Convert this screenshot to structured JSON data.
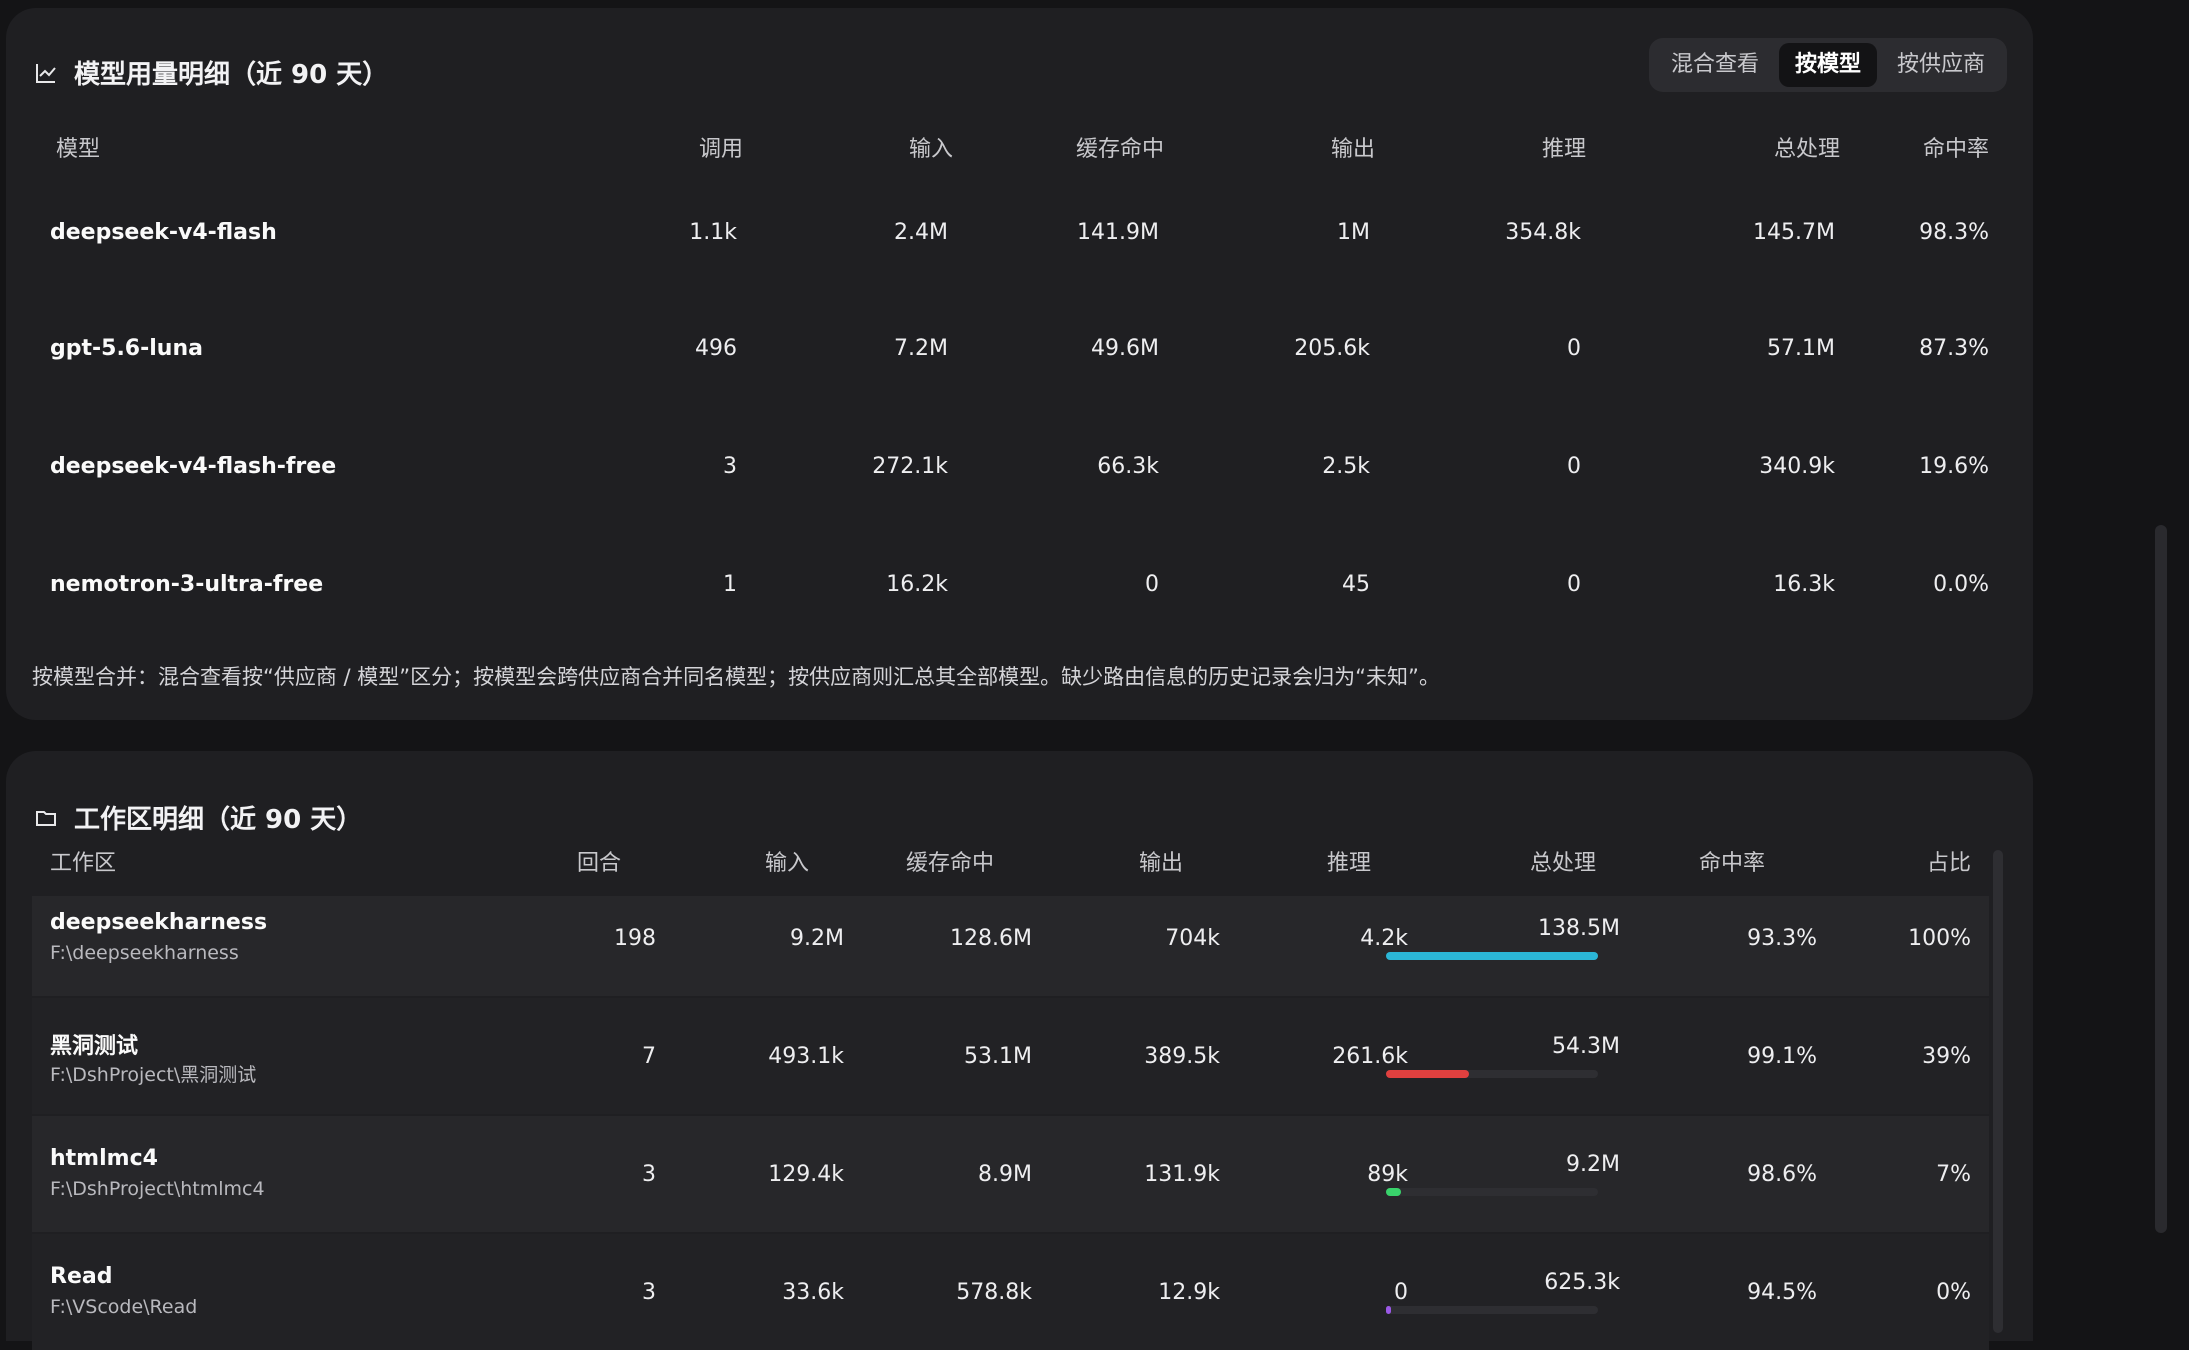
{
  "model_section": {
    "title": "模型用量明细（近 90 天）",
    "icon": "line-chart-icon",
    "tabs": [
      {
        "label": "混合查看",
        "active": false
      },
      {
        "label": "按模型",
        "active": true
      },
      {
        "label": "按供应商",
        "active": false
      }
    ],
    "columns": [
      "模型",
      "调用",
      "输入",
      "缓存命中",
      "输出",
      "推理",
      "总处理",
      "命中率"
    ],
    "rows": [
      {
        "model": "deepseek-v4-flash",
        "calls": "1.1k",
        "input": "2.4M",
        "cache": "141.9M",
        "output": "1M",
        "reasoning": "354.8k",
        "total": "145.7M",
        "hit": "98.3%"
      },
      {
        "model": "gpt-5.6-luna",
        "calls": "496",
        "input": "7.2M",
        "cache": "49.6M",
        "output": "205.6k",
        "reasoning": "0",
        "total": "57.1M",
        "hit": "87.3%"
      },
      {
        "model": "deepseek-v4-flash-free",
        "calls": "3",
        "input": "272.1k",
        "cache": "66.3k",
        "output": "2.5k",
        "reasoning": "0",
        "total": "340.9k",
        "hit": "19.6%"
      },
      {
        "model": "nemotron-3-ultra-free",
        "calls": "1",
        "input": "16.2k",
        "cache": "0",
        "output": "45",
        "reasoning": "0",
        "total": "16.3k",
        "hit": "0.0%"
      }
    ],
    "note": "按模型合并：混合查看按“供应商 / 模型”区分；按模型会跨供应商合并同名模型；按供应商则汇总其全部模型。缺少路由信息的历史记录会归为“未知”。"
  },
  "workspace_section": {
    "title": "工作区明细（近 90 天）",
    "icon": "folder-icon",
    "columns": [
      "工作区",
      "回合",
      "输入",
      "缓存命中",
      "输出",
      "推理",
      "总处理",
      "命中率",
      "占比"
    ],
    "rows": [
      {
        "name": "deepseekharness",
        "path": "F:\\deepseekharness",
        "turns": "198",
        "input": "9.2M",
        "cache": "128.6M",
        "output": "704k",
        "reasoning": "4.2k",
        "total": "138.5M",
        "bar_fraction": 1.0,
        "bar_color": "#2bb6d6",
        "hit": "93.3%",
        "share": "100%"
      },
      {
        "name": "黑洞测试",
        "path": "F:\\DshProject\\黑洞测试",
        "turns": "7",
        "input": "493.1k",
        "cache": "53.1M",
        "output": "389.5k",
        "reasoning": "261.6k",
        "total": "54.3M",
        "bar_fraction": 0.39,
        "bar_color": "#e0403f",
        "hit": "99.1%",
        "share": "39%"
      },
      {
        "name": "htmlmc4",
        "path": "F:\\DshProject\\htmlmc4",
        "turns": "3",
        "input": "129.4k",
        "cache": "8.9M",
        "output": "131.9k",
        "reasoning": "89k",
        "total": "9.2M",
        "bar_fraction": 0.07,
        "bar_color": "#39d36b",
        "hit": "98.6%",
        "share": "7%"
      },
      {
        "name": "Read",
        "path": "F:\\VScode\\Read",
        "turns": "3",
        "input": "33.6k",
        "cache": "578.8k",
        "output": "12.9k",
        "reasoning": "0",
        "total": "625.3k",
        "bar_fraction": 0.005,
        "bar_color": "#9b59e6",
        "hit": "94.5%",
        "share": "0%"
      }
    ]
  }
}
